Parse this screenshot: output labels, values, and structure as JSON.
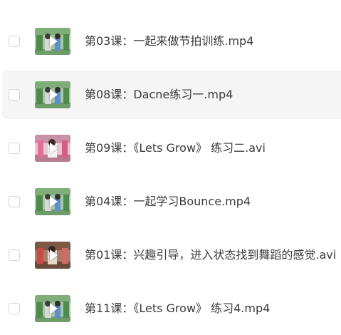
{
  "files": [
    {
      "name": "第03课：一起来做节拍训练.mp4",
      "thumb": "green",
      "selected": false,
      "hover": false
    },
    {
      "name": "第08课：Dacne练习一.mp4",
      "thumb": "green",
      "selected": false,
      "hover": true
    },
    {
      "name": "第09课：《Lets  Grow》 练习二.avi",
      "thumb": "pink",
      "selected": false,
      "hover": false
    },
    {
      "name": "第04课：一起学习Bounce.mp4",
      "thumb": "green",
      "selected": false,
      "hover": false
    },
    {
      "name": "第01课：兴趣引导，进入状态找到舞蹈的感觉.avi",
      "thumb": "brown",
      "selected": false,
      "hover": false
    },
    {
      "name": "第11课：《Lets  Grow》 练习4.mp4",
      "thumb": "green",
      "selected": false,
      "hover": false
    }
  ],
  "colors": {
    "text": "#3a3a3c",
    "hover_bg": "#f5f5f6",
    "checkbox_border": "#d4d7de"
  }
}
